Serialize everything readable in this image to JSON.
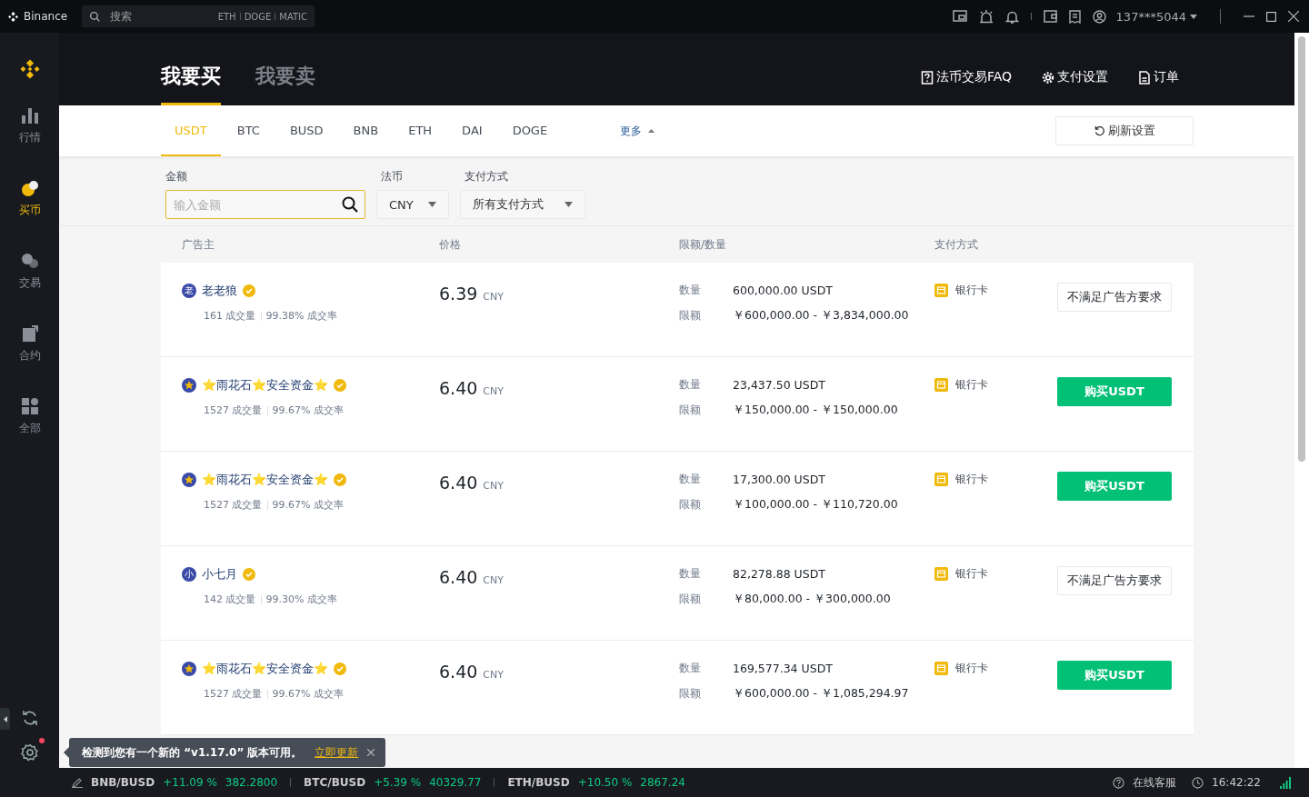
{
  "app": {
    "title": "Binance"
  },
  "search": {
    "placeholder": "搜索",
    "hints": [
      "ETH",
      "DOGE",
      "MATIC"
    ]
  },
  "account": {
    "user": "137***5044"
  },
  "sidebar": {
    "items": [
      {
        "label": "行情",
        "selected": false
      },
      {
        "label": "买币",
        "selected": true
      },
      {
        "label": "交易",
        "selected": false
      },
      {
        "label": "合约",
        "selected": false
      },
      {
        "label": "全部",
        "selected": false
      }
    ],
    "settings_badge": true
  },
  "header": {
    "tabs": [
      {
        "label": "我要买",
        "selected": true
      },
      {
        "label": "我要卖",
        "selected": false
      }
    ],
    "links": [
      {
        "label": "法币交易FAQ"
      },
      {
        "label": "支付设置"
      },
      {
        "label": "订单"
      }
    ]
  },
  "assets": {
    "tabs": [
      {
        "label": "USDT",
        "selected": true
      },
      {
        "label": "BTC",
        "selected": false
      },
      {
        "label": "BUSD",
        "selected": false
      },
      {
        "label": "BNB",
        "selected": false
      },
      {
        "label": "ETH",
        "selected": false
      },
      {
        "label": "DAI",
        "selected": false
      },
      {
        "label": "DOGE",
        "selected": false
      }
    ],
    "more": "更多",
    "refresh": "刷新设置"
  },
  "filters": {
    "amount": {
      "label": "金额",
      "placeholder": "输入金额"
    },
    "fiat": {
      "label": "法币",
      "value": "CNY"
    },
    "payment": {
      "label": "支付方式",
      "value": "所有支付方式"
    }
  },
  "table": {
    "columns": [
      "广告主",
      "价格",
      "限额/数量",
      "支付方式"
    ],
    "rows": [
      {
        "avatar": {
          "kind": "letter",
          "letter": "老"
        },
        "name": "老老狼",
        "verified": true,
        "trades": "161 成交量",
        "rate": "99.38% 成交率",
        "price": "6.39",
        "currency": "CNY",
        "qty_label": "数量",
        "qty": "600,000.00 USDT",
        "limit_label": "限额",
        "limit": "￥600,000.00 - ￥3,834,000.00",
        "payment": "银行卡",
        "action": {
          "kind": "disabled",
          "label": "不满足广告方要求"
        }
      },
      {
        "avatar": {
          "kind": "star"
        },
        "name": "⭐雨花石⭐安全资金⭐",
        "verified": true,
        "trades": "1527 成交量",
        "rate": "99.67% 成交率",
        "price": "6.40",
        "currency": "CNY",
        "qty_label": "数量",
        "qty": "23,437.50 USDT",
        "limit_label": "限额",
        "limit": "￥150,000.00 - ￥150,000.00",
        "payment": "银行卡",
        "action": {
          "kind": "buy",
          "label": "购买USDT"
        }
      },
      {
        "avatar": {
          "kind": "star"
        },
        "name": "⭐雨花石⭐安全资金⭐",
        "verified": true,
        "trades": "1527 成交量",
        "rate": "99.67% 成交率",
        "price": "6.40",
        "currency": "CNY",
        "qty_label": "数量",
        "qty": "17,300.00 USDT",
        "limit_label": "限额",
        "limit": "￥100,000.00 - ￥110,720.00",
        "payment": "银行卡",
        "action": {
          "kind": "buy",
          "label": "购买USDT"
        }
      },
      {
        "avatar": {
          "kind": "letter",
          "letter": "小"
        },
        "name": "小七月",
        "verified": true,
        "trades": "142 成交量",
        "rate": "99.30% 成交率",
        "price": "6.40",
        "currency": "CNY",
        "qty_label": "数量",
        "qty": "82,278.88 USDT",
        "limit_label": "限额",
        "limit": "￥80,000.00 - ￥300,000.00",
        "payment": "银行卡",
        "action": {
          "kind": "disabled",
          "label": "不满足广告方要求"
        }
      },
      {
        "avatar": {
          "kind": "star"
        },
        "name": "⭐雨花石⭐安全资金⭐",
        "verified": true,
        "trades": "1527 成交量",
        "rate": "99.67% 成交率",
        "price": "6.40",
        "currency": "CNY",
        "qty_label": "数量",
        "qty": "169,577.34 USDT",
        "limit_label": "限额",
        "limit": "￥600,000.00 - ￥1,085,294.97",
        "payment": "银行卡",
        "action": {
          "kind": "buy",
          "label": "购买USDT"
        }
      }
    ]
  },
  "toast": {
    "message": "检测到您有一个新的 “v1.17.0” 版本可用。",
    "link": "立即更新"
  },
  "status_bar": {
    "tickers": [
      {
        "pair": "BNB/BUSD",
        "change": "+11.09 %",
        "price": "382.2800"
      },
      {
        "pair": "BTC/BUSD",
        "change": "+5.39 %",
        "price": "40329.77"
      },
      {
        "pair": "ETH/BUSD",
        "change": "+10.50 %",
        "price": "2867.24"
      }
    ],
    "support": "在线客服",
    "time": "16:42:22"
  }
}
